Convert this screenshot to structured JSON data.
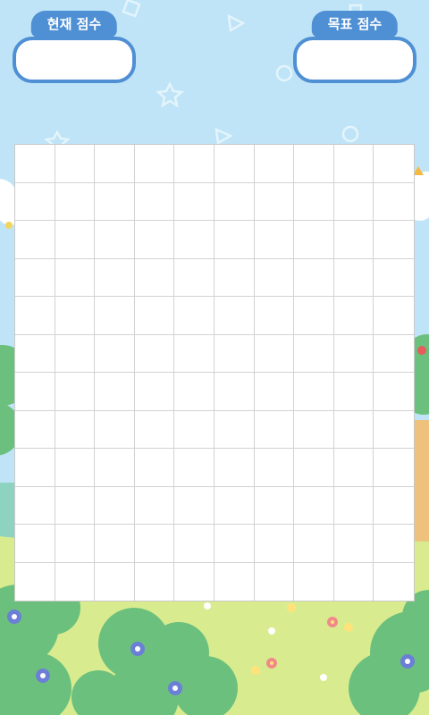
{
  "scores": {
    "current": {
      "label": "현재 점수",
      "value": ""
    },
    "target": {
      "label": "목표 점수",
      "value": ""
    }
  },
  "board": {
    "columns": 10,
    "rows": 12
  },
  "colors": {
    "sky": "#bfe4f7",
    "grass": "#d8ec8f",
    "bush": "#6cc07d",
    "accent": "#4f8fd4"
  },
  "icons": [
    "star-shape",
    "circle-shape",
    "triangle-shape",
    "square-shape",
    "cloud",
    "bush",
    "flower",
    "tree"
  ]
}
